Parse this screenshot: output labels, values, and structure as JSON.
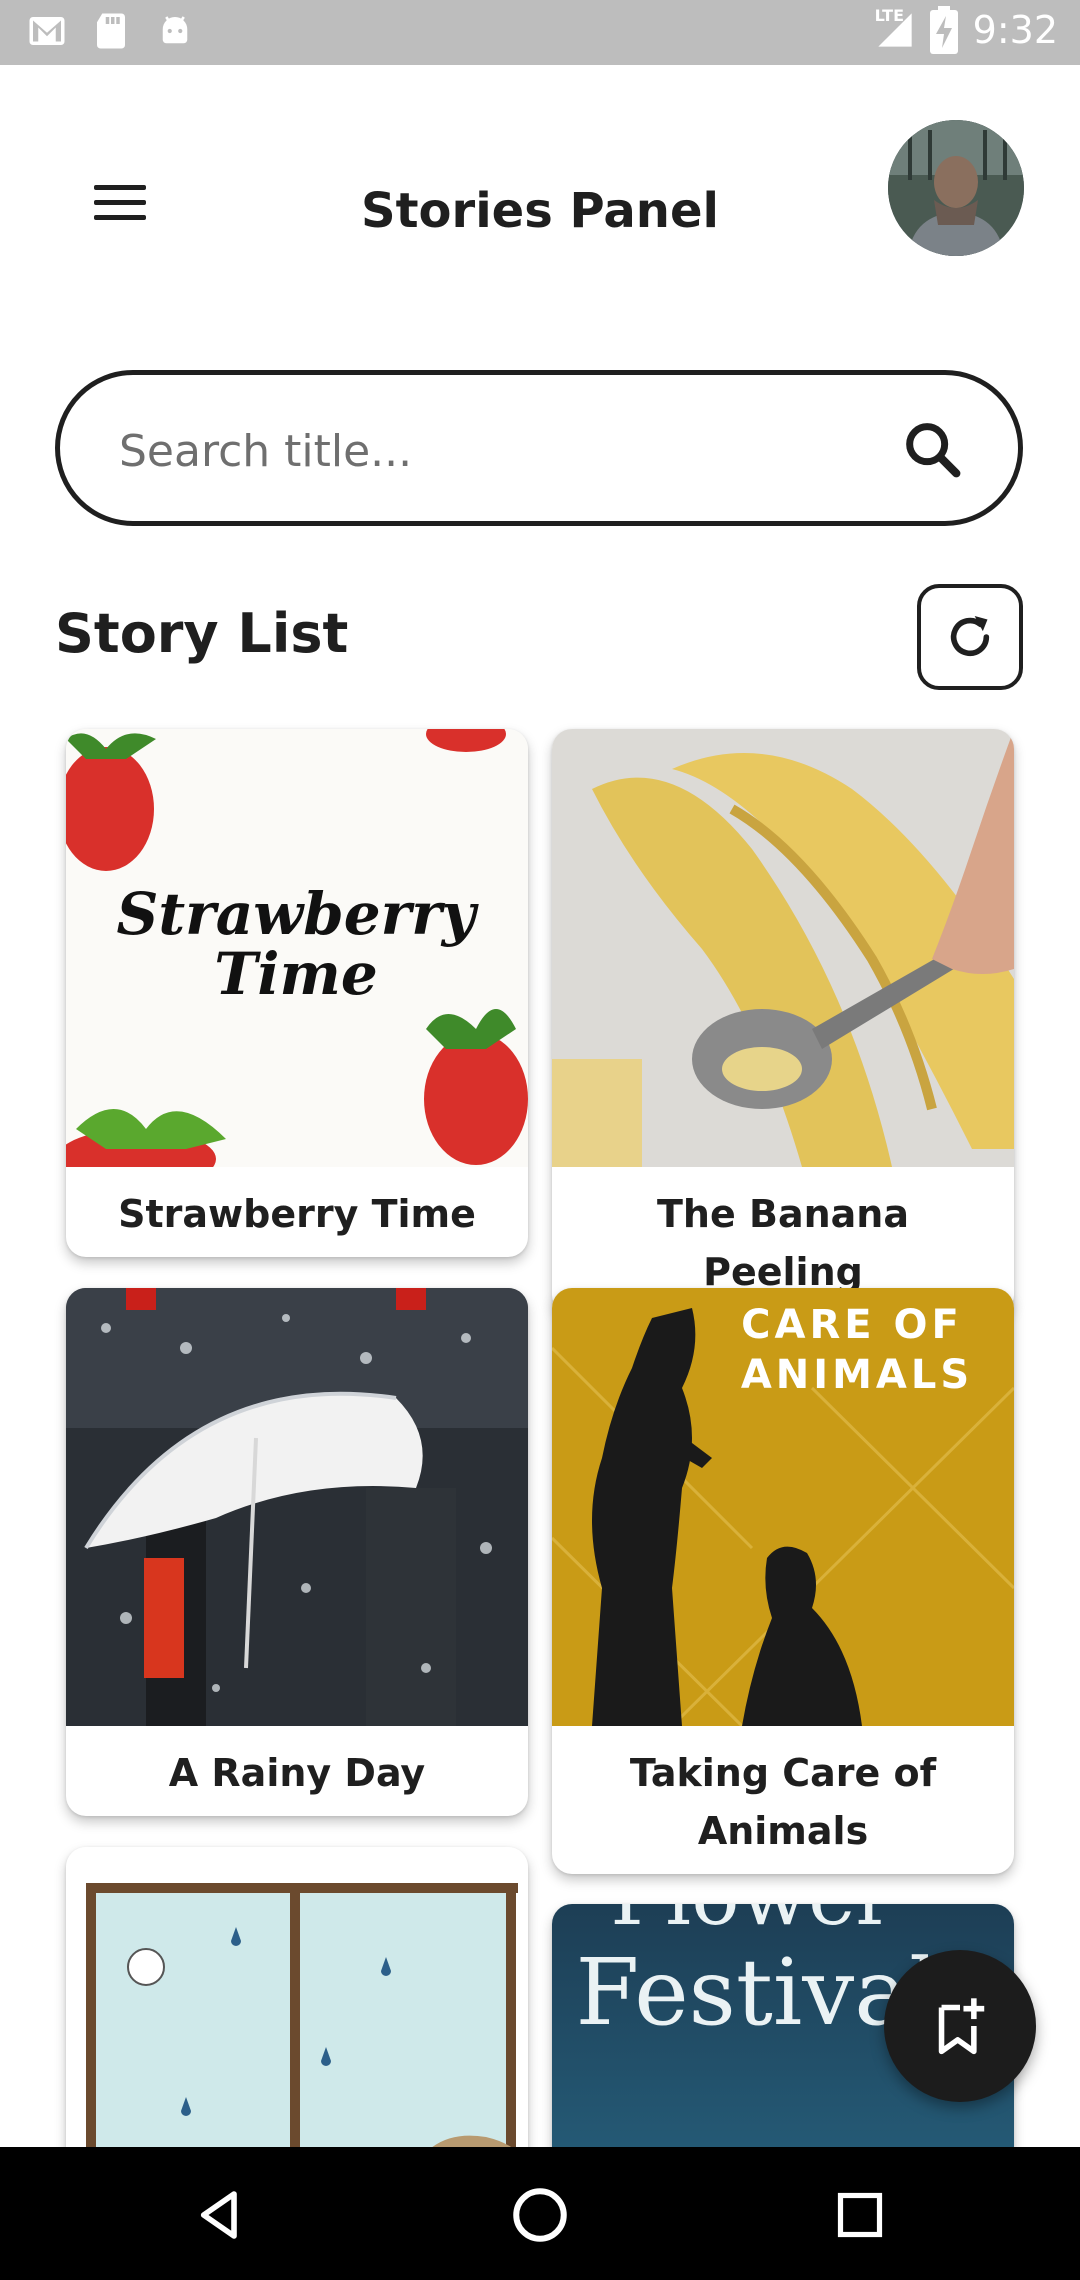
{
  "status_bar": {
    "time": "9:32",
    "network": "LTE",
    "left_icons": [
      "gmail-icon",
      "sd-card-icon",
      "android-icon"
    ],
    "right_icons": [
      "signal-icon",
      "battery-charging-icon"
    ]
  },
  "header": {
    "title": "Stories Panel",
    "menu_icon": "hamburger-menu-icon",
    "avatar_icon": "user-avatar"
  },
  "search": {
    "placeholder": "Search title...",
    "value": "",
    "icon": "search-icon"
  },
  "section": {
    "title": "Story List",
    "refresh_icon": "refresh-icon"
  },
  "stories": [
    {
      "title": "Strawberry Time",
      "cover_text": [
        "Strawberry",
        "Time"
      ],
      "cover_theme": "strawberries"
    },
    {
      "title": "The Banana Peeling",
      "cover_theme": "banana-peel-spoon"
    },
    {
      "title": "A Rainy Day",
      "cover_theme": "umbrella-rain"
    },
    {
      "title": "Taking Care of Animals",
      "cover_text": [
        "CARE OF",
        "ANIMALS"
      ],
      "cover_theme": "dog-silhouette"
    },
    {
      "title": "",
      "cover_theme": "rainy-window-illustration"
    },
    {
      "title": "",
      "cover_text": [
        "Flower",
        "Festival"
      ],
      "cover_theme": "flower-festival"
    }
  ],
  "fab": {
    "icon": "bookmark-add-icon"
  },
  "nav_bar": {
    "icons": [
      "back-icon",
      "home-icon",
      "recents-icon"
    ]
  },
  "colors": {
    "status_bar": "#bdbdbd",
    "text": "#1f1f1f",
    "fab": "#1c1c1c",
    "nav_bar": "#000000"
  }
}
